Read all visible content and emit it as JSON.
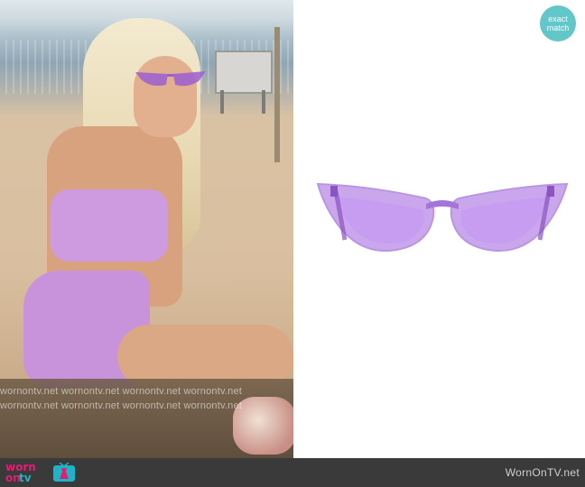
{
  "badge": {
    "line1": "exact",
    "line2": "match"
  },
  "watermark": {
    "row1": "wornontv.net  wornontv.net  wornontv.net  wornontv.net",
    "row2": "wornontv.net  wornontv.net  wornontv.net  wornontv.net"
  },
  "product": {
    "icon": "cat-eye-sunglasses-icon",
    "frame_color": "#b98ae8",
    "lens_color": "#c79cf2"
  },
  "footer": {
    "logo_worn": "worn",
    "logo_on": "on",
    "logo_tv": "tv",
    "site": "WornOnTV.net",
    "brand_pink": "#e11d74",
    "brand_teal": "#1fb3c7"
  }
}
